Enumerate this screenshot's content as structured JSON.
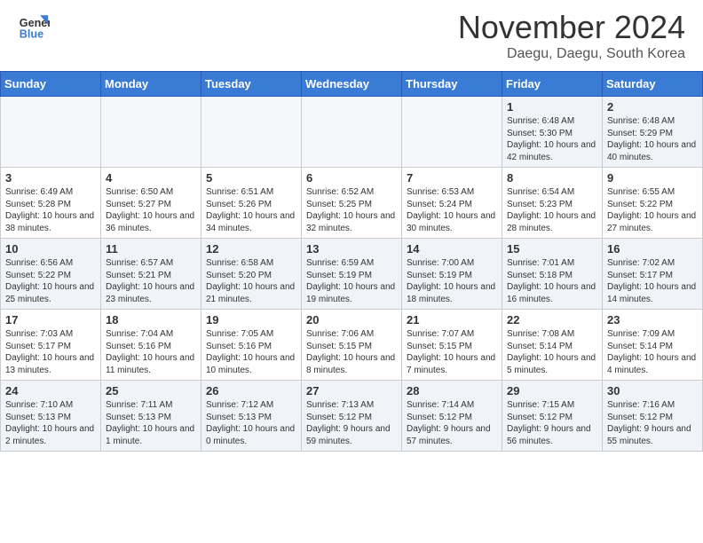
{
  "header": {
    "logo_line1": "General",
    "logo_line2": "Blue",
    "month_title": "November 2024",
    "location": "Daegu, Daegu, South Korea"
  },
  "days_of_week": [
    "Sunday",
    "Monday",
    "Tuesday",
    "Wednesday",
    "Thursday",
    "Friday",
    "Saturday"
  ],
  "weeks": [
    [
      {
        "num": "",
        "content": ""
      },
      {
        "num": "",
        "content": ""
      },
      {
        "num": "",
        "content": ""
      },
      {
        "num": "",
        "content": ""
      },
      {
        "num": "",
        "content": ""
      },
      {
        "num": "1",
        "content": "Sunrise: 6:48 AM\nSunset: 5:30 PM\nDaylight: 10 hours and 42 minutes."
      },
      {
        "num": "2",
        "content": "Sunrise: 6:48 AM\nSunset: 5:29 PM\nDaylight: 10 hours and 40 minutes."
      }
    ],
    [
      {
        "num": "3",
        "content": "Sunrise: 6:49 AM\nSunset: 5:28 PM\nDaylight: 10 hours and 38 minutes."
      },
      {
        "num": "4",
        "content": "Sunrise: 6:50 AM\nSunset: 5:27 PM\nDaylight: 10 hours and 36 minutes."
      },
      {
        "num": "5",
        "content": "Sunrise: 6:51 AM\nSunset: 5:26 PM\nDaylight: 10 hours and 34 minutes."
      },
      {
        "num": "6",
        "content": "Sunrise: 6:52 AM\nSunset: 5:25 PM\nDaylight: 10 hours and 32 minutes."
      },
      {
        "num": "7",
        "content": "Sunrise: 6:53 AM\nSunset: 5:24 PM\nDaylight: 10 hours and 30 minutes."
      },
      {
        "num": "8",
        "content": "Sunrise: 6:54 AM\nSunset: 5:23 PM\nDaylight: 10 hours and 28 minutes."
      },
      {
        "num": "9",
        "content": "Sunrise: 6:55 AM\nSunset: 5:22 PM\nDaylight: 10 hours and 27 minutes."
      }
    ],
    [
      {
        "num": "10",
        "content": "Sunrise: 6:56 AM\nSunset: 5:22 PM\nDaylight: 10 hours and 25 minutes."
      },
      {
        "num": "11",
        "content": "Sunrise: 6:57 AM\nSunset: 5:21 PM\nDaylight: 10 hours and 23 minutes."
      },
      {
        "num": "12",
        "content": "Sunrise: 6:58 AM\nSunset: 5:20 PM\nDaylight: 10 hours and 21 minutes."
      },
      {
        "num": "13",
        "content": "Sunrise: 6:59 AM\nSunset: 5:19 PM\nDaylight: 10 hours and 19 minutes."
      },
      {
        "num": "14",
        "content": "Sunrise: 7:00 AM\nSunset: 5:19 PM\nDaylight: 10 hours and 18 minutes."
      },
      {
        "num": "15",
        "content": "Sunrise: 7:01 AM\nSunset: 5:18 PM\nDaylight: 10 hours and 16 minutes."
      },
      {
        "num": "16",
        "content": "Sunrise: 7:02 AM\nSunset: 5:17 PM\nDaylight: 10 hours and 14 minutes."
      }
    ],
    [
      {
        "num": "17",
        "content": "Sunrise: 7:03 AM\nSunset: 5:17 PM\nDaylight: 10 hours and 13 minutes."
      },
      {
        "num": "18",
        "content": "Sunrise: 7:04 AM\nSunset: 5:16 PM\nDaylight: 10 hours and 11 minutes."
      },
      {
        "num": "19",
        "content": "Sunrise: 7:05 AM\nSunset: 5:16 PM\nDaylight: 10 hours and 10 minutes."
      },
      {
        "num": "20",
        "content": "Sunrise: 7:06 AM\nSunset: 5:15 PM\nDaylight: 10 hours and 8 minutes."
      },
      {
        "num": "21",
        "content": "Sunrise: 7:07 AM\nSunset: 5:15 PM\nDaylight: 10 hours and 7 minutes."
      },
      {
        "num": "22",
        "content": "Sunrise: 7:08 AM\nSunset: 5:14 PM\nDaylight: 10 hours and 5 minutes."
      },
      {
        "num": "23",
        "content": "Sunrise: 7:09 AM\nSunset: 5:14 PM\nDaylight: 10 hours and 4 minutes."
      }
    ],
    [
      {
        "num": "24",
        "content": "Sunrise: 7:10 AM\nSunset: 5:13 PM\nDaylight: 10 hours and 2 minutes."
      },
      {
        "num": "25",
        "content": "Sunrise: 7:11 AM\nSunset: 5:13 PM\nDaylight: 10 hours and 1 minute."
      },
      {
        "num": "26",
        "content": "Sunrise: 7:12 AM\nSunset: 5:13 PM\nDaylight: 10 hours and 0 minutes."
      },
      {
        "num": "27",
        "content": "Sunrise: 7:13 AM\nSunset: 5:12 PM\nDaylight: 9 hours and 59 minutes."
      },
      {
        "num": "28",
        "content": "Sunrise: 7:14 AM\nSunset: 5:12 PM\nDaylight: 9 hours and 57 minutes."
      },
      {
        "num": "29",
        "content": "Sunrise: 7:15 AM\nSunset: 5:12 PM\nDaylight: 9 hours and 56 minutes."
      },
      {
        "num": "30",
        "content": "Sunrise: 7:16 AM\nSunset: 5:12 PM\nDaylight: 9 hours and 55 minutes."
      }
    ]
  ]
}
